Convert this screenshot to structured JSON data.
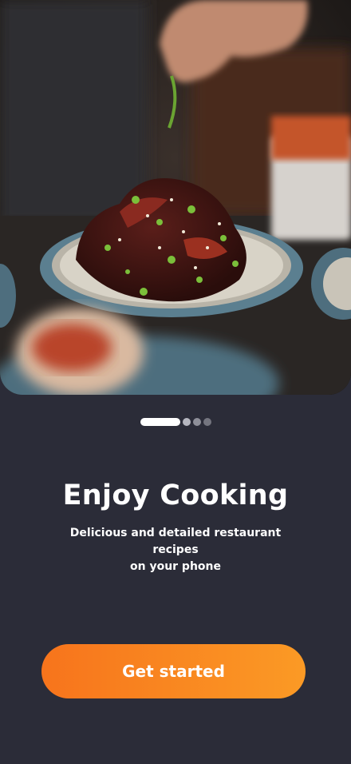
{
  "hero": {
    "image": "plated-dish-photo"
  },
  "pager": {
    "total": 4,
    "active_index": 0
  },
  "title": "Enjoy Cooking",
  "subtitle_line1": "Delicious and detailed restaurant recipes",
  "subtitle_line2": "on your phone",
  "cta": {
    "label": "Get started"
  },
  "colors": {
    "background": "#2b2c38",
    "accent_start": "#f7741c",
    "accent_end": "#fb9a25",
    "text": "#ffffff"
  }
}
